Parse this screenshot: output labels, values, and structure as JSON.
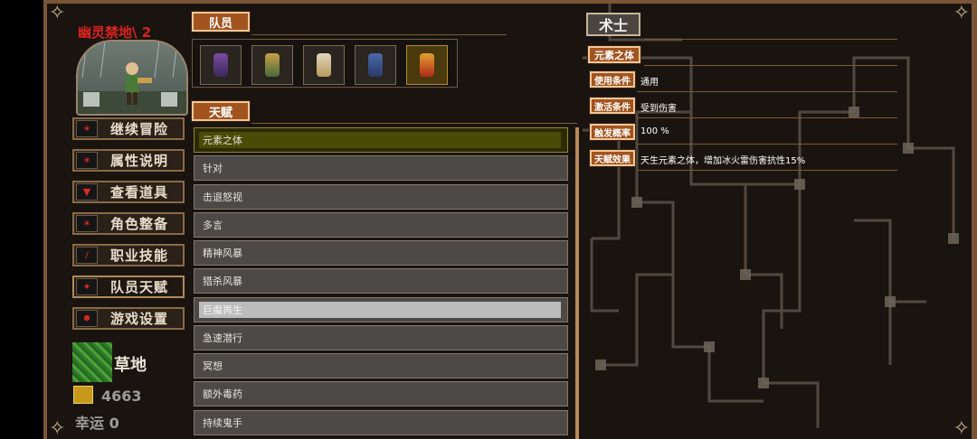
{
  "location": {
    "name": "幽灵禁地",
    "level_text": "\\ 2"
  },
  "menu": [
    {
      "label": "继续冒险",
      "icon": "map-icon"
    },
    {
      "label": "属性说明",
      "icon": "stats-icon"
    },
    {
      "label": "查看道具",
      "icon": "bag-icon"
    },
    {
      "label": "角色整备",
      "icon": "armor-icon"
    },
    {
      "label": "职业技能",
      "icon": "sword-icon"
    },
    {
      "label": "队员天赋",
      "icon": "talent-icon"
    },
    {
      "label": "游戏设置",
      "icon": "gear-icon"
    }
  ],
  "status": {
    "terrain": "草地",
    "gold": "4663",
    "luck": "幸运 0"
  },
  "party": {
    "title": "队员",
    "members": [
      "mage-hero",
      "ranger-hero",
      "priest-hero",
      "knight-hero",
      "warlock-hero"
    ],
    "selected_index": 4
  },
  "talents": {
    "title": "天赋",
    "items": [
      "元素之体",
      "针对",
      "击退怒视",
      "多言",
      "精神风暴",
      "猎杀风暴",
      "巨魔再生",
      "急速潜行",
      "冥想",
      "额外毒药",
      "持续鬼手"
    ],
    "highlighted_index": 0,
    "selected_index": 6
  },
  "detail": {
    "class_name": "术士",
    "talent_name": "元素之体",
    "rows": [
      {
        "key": "使用条件",
        "value": "通用"
      },
      {
        "key": "激活条件",
        "value": "受到伤害"
      },
      {
        "key": "触发概率",
        "value": "100 %"
      },
      {
        "key": "天赋效果",
        "value": "天生元素之体，增加冰火雷伤害抗性15%"
      }
    ]
  },
  "colors": {
    "tag_bg": "#a2541f",
    "frame": "#7a5636",
    "level_red": "#d8231f"
  }
}
